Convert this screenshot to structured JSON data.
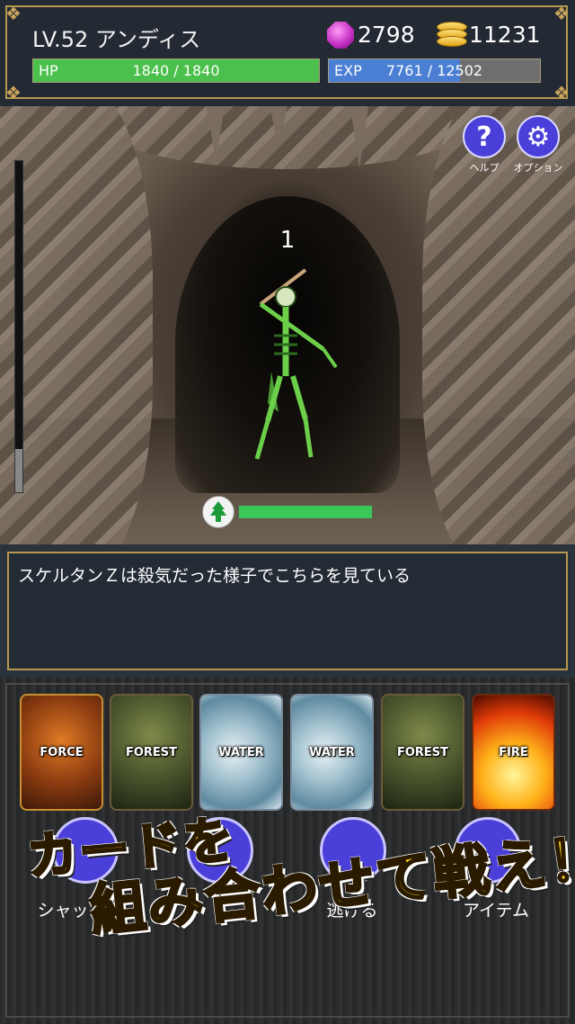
{
  "player": {
    "name_level": "LV.52 アンディス",
    "gems": "2798",
    "coins": "11231",
    "hp": {
      "label": "HP",
      "value": "1840 / 1840",
      "fraction": 1.0,
      "color": "#4cc04c"
    },
    "exp": {
      "label": "EXP",
      "value": "7761 / 12502",
      "fraction": 0.62,
      "color": "#4a7fd4"
    }
  },
  "scene": {
    "turn_count": "1",
    "enemy_name": "スケルタン Z",
    "enemy_hp_fraction": 1.0,
    "enemy_element_icon": "tree-icon",
    "side_gauge_fraction": 0.13
  },
  "buttons": {
    "help": {
      "caption": "ヘルプ",
      "icon": "question-icon"
    },
    "options": {
      "caption": "オプション",
      "icon": "gear-icon"
    }
  },
  "message": "スケルタンＺは殺気だった様子でこちらを見ている",
  "cards": [
    {
      "name": "FORCE",
      "type": "force"
    },
    {
      "name": "FOREST",
      "type": "forest"
    },
    {
      "name": "WATER",
      "type": "water"
    },
    {
      "name": "WATER",
      "type": "water"
    },
    {
      "name": "FOREST",
      "type": "forest"
    },
    {
      "name": "FIRE",
      "type": "fire"
    }
  ],
  "actions": [
    {
      "label": "シャッ"
    },
    {
      "label": "逃げる"
    },
    {
      "label": "アイテム"
    }
  ],
  "promo": {
    "line1": "カードを",
    "line2": "組み合わせて戦え！"
  },
  "colors": {
    "accent_gold": "#b8964f",
    "button_purple": "#4b3fd9",
    "promo_yellow": "#ffd21f"
  }
}
